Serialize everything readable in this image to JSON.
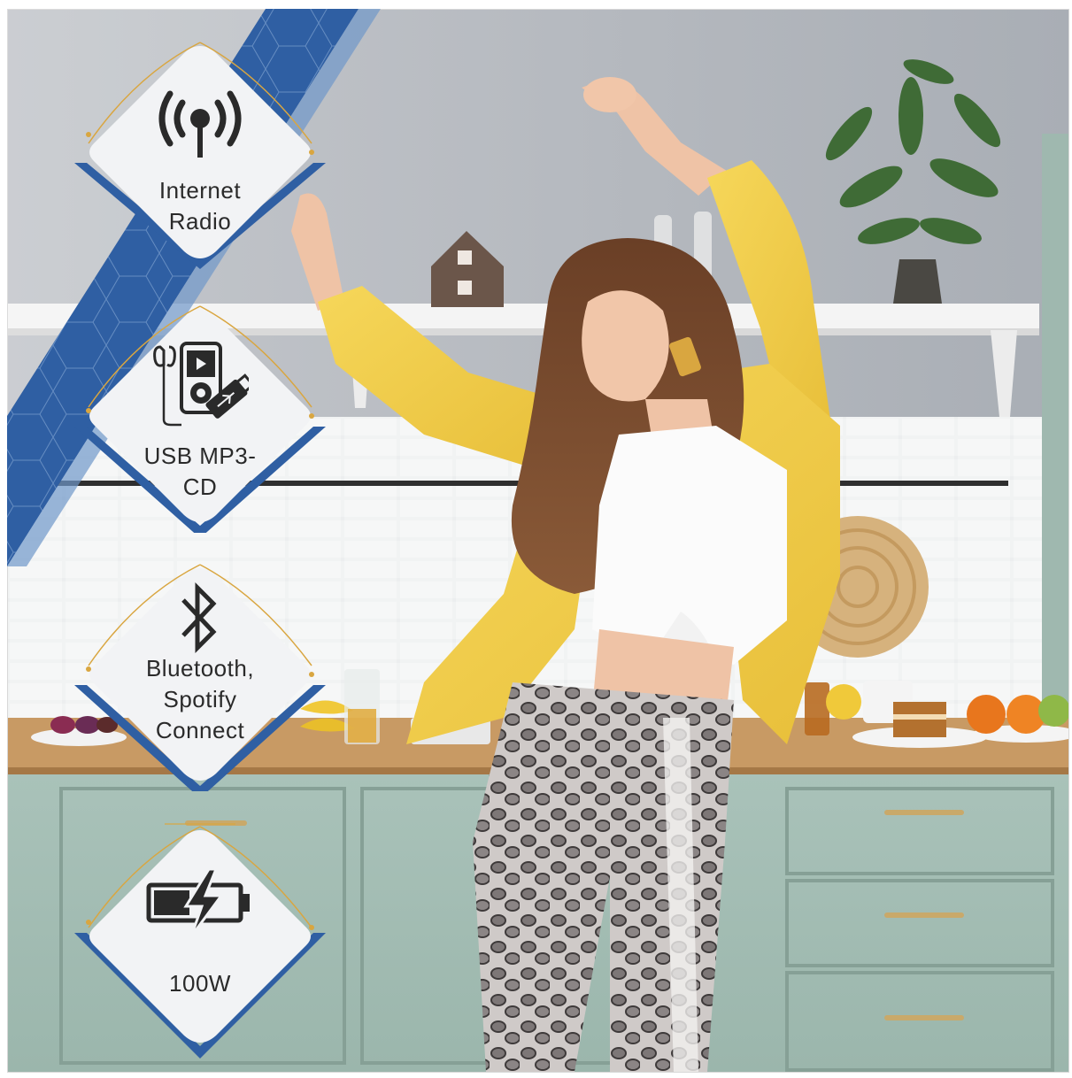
{
  "colors": {
    "brand_blue": "#2f5fa3",
    "brand_blue_light": "#6f97c9",
    "accent_gold": "#d9a640",
    "badge_fill": "#f2f3f5",
    "icon_dark": "#2a2a2a"
  },
  "features": [
    {
      "icon": "internet-radio-icon",
      "label": "Internet\nRadio"
    },
    {
      "icon": "usb-mp3-cd-icon",
      "label": "USB MP3-\nCD"
    },
    {
      "icon": "bluetooth-icon",
      "label": "Bluetooth,\nSpotify\nConnect"
    },
    {
      "icon": "battery-charging-icon",
      "label": "100W"
    }
  ]
}
